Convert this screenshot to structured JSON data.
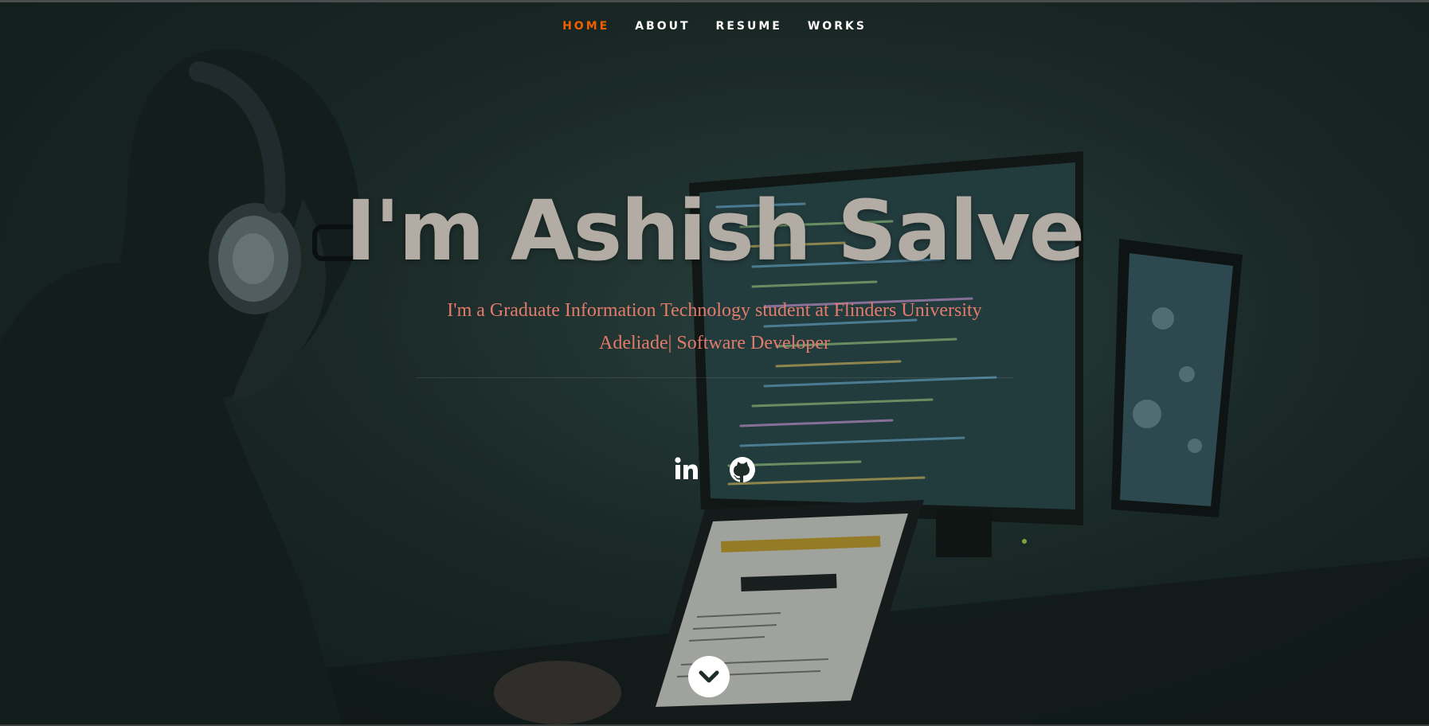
{
  "nav": {
    "items": [
      {
        "label": "HOME",
        "active": true
      },
      {
        "label": "ABOUT",
        "active": false
      },
      {
        "label": "RESUME",
        "active": false
      },
      {
        "label": "WORKS",
        "active": false
      }
    ]
  },
  "hero": {
    "headline": "I'm Ashish Salve",
    "subtitle_line1": "I'm a Graduate Information Technology student at Flinders University",
    "subtitle_line2": "Adeliade| Software Developer"
  },
  "social": [
    {
      "icon": "linkedin-icon"
    },
    {
      "icon": "github-icon"
    }
  ],
  "scroll": {
    "icon": "chevron-down-icon"
  },
  "colors": {
    "nav_active": "#f06000",
    "nav_text": "#ffffff",
    "headline": "#b3aca4",
    "subtitle": "#e27b6b",
    "background": "#1e2d2a"
  }
}
